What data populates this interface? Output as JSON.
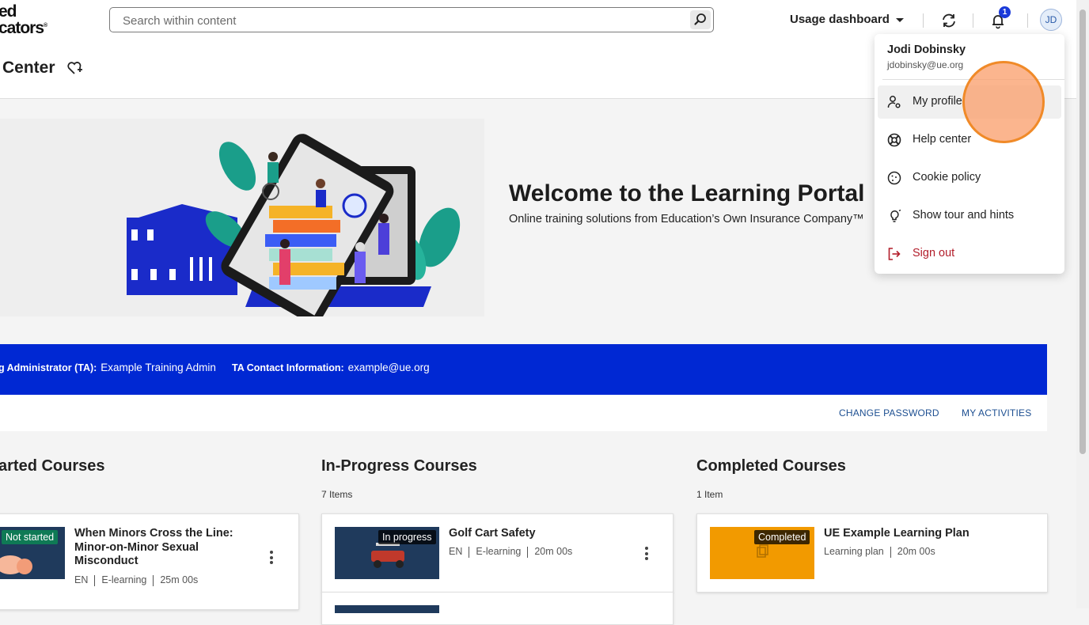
{
  "header": {
    "logo_line1": "ed",
    "logo_line2": "cators",
    "search_placeholder": "Search within content",
    "usage_label": "Usage dashboard",
    "notification_count": "1",
    "avatar_initials": "JD"
  },
  "subheader": {
    "page_title": "Center"
  },
  "hero": {
    "title": "Welcome to the Learning Portal",
    "subtitle": "Online training solutions from Education’s Own Insurance Company™"
  },
  "ta_bar": {
    "admin_label": "g Administrator (TA):",
    "admin_value": "Example Training Admin",
    "contact_label": "TA Contact Information:",
    "contact_value": "example@ue.org",
    "bg_color": "#0028d3"
  },
  "links": {
    "change_password": "CHANGE PASSWORD",
    "my_activities": "MY ACTIVITIES"
  },
  "columns": {
    "not_started": {
      "title": "arted Courses",
      "card": {
        "status": "Not started",
        "title": "When Minors Cross the Line: Minor-on-Minor Sexual Misconduct",
        "meta": [
          "EN",
          "E-learning",
          "25m 00s"
        ]
      }
    },
    "in_progress": {
      "title": "In-Progress Courses",
      "count": "7 Items",
      "card": {
        "status": "In progress",
        "title": "Golf Cart Safety",
        "meta": [
          "EN",
          "E-learning",
          "20m 00s"
        ]
      }
    },
    "completed": {
      "title": "Completed Courses",
      "count": "1 Item",
      "card": {
        "status": "Completed",
        "title": "UE Example Learning Plan",
        "meta": [
          "Learning plan",
          "20m 00s"
        ]
      }
    }
  },
  "user_menu": {
    "name": "Jodi Dobinsky",
    "email": "jdobinsky@ue.org",
    "items": [
      {
        "label": "My profile",
        "icon": "user-settings-icon"
      },
      {
        "label": "Help center",
        "icon": "lifebuoy-icon"
      },
      {
        "label": "Cookie policy",
        "icon": "cookie-icon"
      },
      {
        "label": "Show tour and hints",
        "icon": "lightbulb-icon"
      },
      {
        "label": "Sign out",
        "icon": "sign-out-icon"
      }
    ]
  },
  "colors": {
    "accent_blue": "#0028d3",
    "link_blue": "#1d4f91",
    "sign_out_red": "#b21d2a",
    "completed_orange": "#f29a00"
  }
}
